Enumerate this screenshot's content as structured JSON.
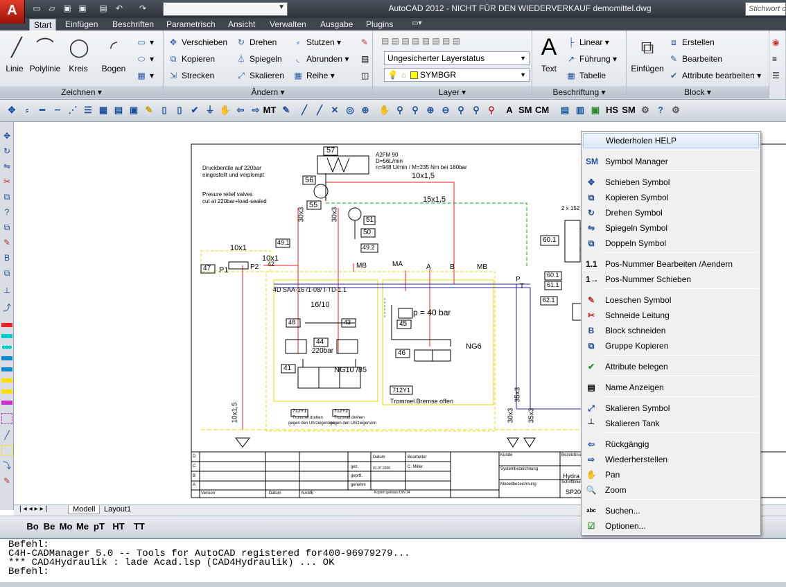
{
  "titlebar": {
    "title": "AutoCAD 2012 - NICHT FÜR DEN WIEDERVERKAUF    demomittel.dwg",
    "search_placeholder": "Stichwort oder",
    "logo": "A"
  },
  "tabs": [
    "Start",
    "Einfügen",
    "Beschriften",
    "Parametrisch",
    "Ansicht",
    "Verwalten",
    "Ausgabe",
    "Plugins"
  ],
  "ribbon": {
    "zeichnen": {
      "label": "Zeichnen",
      "buttons": [
        "Linie",
        "Polylinie",
        "Kreis",
        "Bogen"
      ]
    },
    "aendern": {
      "label": "Ändern",
      "items": [
        "Verschieben",
        "Drehen",
        "Stutzen",
        "Kopieren",
        "Spiegeln",
        "Abrunden",
        "Strecken",
        "Skalieren",
        "Reihe"
      ]
    },
    "layer": {
      "label": "Layer",
      "state": "Ungesicherter Layerstatus",
      "current": "SYMBGR"
    },
    "beschriftung": {
      "label": "Beschriftung",
      "text": "Text",
      "items": [
        "Linear",
        "Führung",
        "Tabelle"
      ]
    },
    "block": {
      "label": "Block",
      "einfuegen": "Einfügen",
      "items": [
        "Erstellen",
        "Bearbeiten",
        "Attribute bearbeiten"
      ]
    }
  },
  "toolbar1_icons": [
    "MT",
    "HS",
    "SM"
  ],
  "layout_tabs": [
    "Modell",
    "Layout1"
  ],
  "toolbar2": [
    "Bo",
    "Be",
    "Mo",
    "Me",
    "pT",
    "HT",
    "TT"
  ],
  "command_lines": [
    "Befehl:",
    "C4H-CADManager 5.0 -- Tools for AutoCAD registered for400-96979279...",
    "*** CAD4Hydraulik : lade Acad.lsp (CAD4Hydraulik) ... OK",
    "Befehl:"
  ],
  "context_menu": [
    {
      "label": "Wiederholen HELP",
      "icon": ""
    },
    {
      "label": "Symbol Manager",
      "icon": "SM"
    },
    {
      "label": "Schieben Symbol",
      "icon": "✥"
    },
    {
      "label": "Kopieren Symbol",
      "icon": "⧉"
    },
    {
      "label": "Drehen Symbol",
      "icon": "↻"
    },
    {
      "label": "Spiegeln Symbol",
      "icon": "⇋"
    },
    {
      "label": "Doppeln Symbol",
      "icon": "⧉"
    },
    {
      "label": "Pos-Nummer Bearbeiten /Aendern",
      "icon": "1.1"
    },
    {
      "label": "Pos-Nummer Schieben",
      "icon": "1→"
    },
    {
      "label": "Loeschen Symbol",
      "icon": "✎"
    },
    {
      "label": "Schneide Leitung",
      "icon": "✂"
    },
    {
      "label": "Block schneiden",
      "icon": "B"
    },
    {
      "label": "Gruppe Kopieren",
      "icon": "⧉"
    },
    {
      "label": "Attribute belegen",
      "icon": "✔"
    },
    {
      "label": "Name Anzeigen",
      "icon": "▤"
    },
    {
      "label": "Skalieren Symbol",
      "icon": "⤢"
    },
    {
      "label": "Skalieren Tank",
      "icon": "┴"
    },
    {
      "label": "Rückgängig",
      "icon": "⇦"
    },
    {
      "label": "Wiederherstellen",
      "icon": "⇨"
    },
    {
      "label": "Pan",
      "icon": "✋"
    },
    {
      "label": "Zoom",
      "icon": "🔍"
    },
    {
      "label": "Suchen...",
      "icon": "abc"
    },
    {
      "label": "Optionen...",
      "icon": "☑"
    }
  ],
  "drawing": {
    "labels": [
      "57",
      "56",
      "55",
      "51",
      "50",
      "49.2",
      "49.1",
      "47",
      "48",
      "43",
      "42",
      "44",
      "41",
      "45",
      "46",
      "60.1",
      "60.1",
      "61.1",
      "62.1",
      "712Y1",
      "712Y1",
      "712Y2",
      "16/10",
      "220bar",
      "NG10 /85",
      "NG6",
      "p = 40 bar",
      "10x1,5",
      "15x1,5",
      "10x1",
      "10x1",
      "30x3",
      "30x3",
      "35x3",
      "30x3",
      "35x3",
      "10x1,5",
      "P1",
      "P2",
      "MB",
      "MA",
      "A",
      "B",
      "MB",
      "P",
      "T",
      "2 x 152",
      "4D SAA-16 /1-08/ I-TD-1.1"
    ],
    "notes": [
      "A2FM 90",
      "D=56L/min",
      "n=948 U/min / M=235 Nm bei 180bar",
      "Druckbentile auf 220bar",
      "eingestellt und verplompt",
      "Presure relief valves",
      "cut at 220bar+load-sealed",
      "Trommel Bremse offen",
      "Trommel drehen",
      "gegen den Uhrzeigersinn",
      "Trommel drehen",
      "gegen den Uhrzeigersinn"
    ],
    "titleblock": [
      "Datum",
      "Bearbeiter",
      "gez.",
      "01.07.2006",
      "C. Miller",
      "geprft.",
      "genehm",
      "Kunde",
      "Bezeichnung",
      "Systembezeichnung",
      "Hydra",
      "Modellbezeichnung",
      "Schriftlinie",
      "SP20",
      "Version",
      "Datum",
      "NAME",
      "Kopiert gemäss DIN 34"
    ],
    "rows": [
      "D",
      "C",
      "B",
      "A"
    ]
  }
}
